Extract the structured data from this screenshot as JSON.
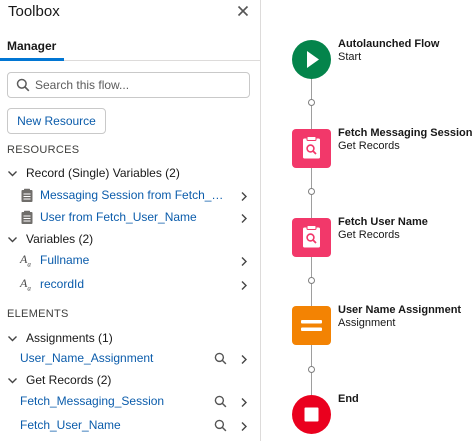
{
  "toolbox": {
    "title": "Toolbox",
    "tabs": [
      {
        "label": "Manager",
        "active": true
      }
    ],
    "search": {
      "placeholder": "Search this flow...",
      "value": ""
    },
    "new_resource_label": "New Resource",
    "resources": {
      "heading": "RESOURCES",
      "groups": [
        {
          "label": "Record (Single) Variables (2)",
          "items": [
            {
              "label": "Messaging Session from Fetch_Messaging_Session",
              "icon": "record-icon"
            },
            {
              "label": "User from Fetch_User_Name",
              "icon": "record-icon"
            }
          ]
        },
        {
          "label": "Variables (2)",
          "items": [
            {
              "label": "Fullname",
              "icon": "text-variable-icon"
            },
            {
              "label": "recordId",
              "icon": "text-variable-icon"
            }
          ]
        }
      ]
    },
    "elements": {
      "heading": "ELEMENTS",
      "groups": [
        {
          "label": "Assignments (1)",
          "items": [
            {
              "label": "User_Name_Assignment"
            }
          ]
        },
        {
          "label": "Get Records (2)",
          "items": [
            {
              "label": "Fetch_Messaging_Session"
            },
            {
              "label": "Fetch_User_Name"
            }
          ]
        }
      ]
    }
  },
  "flow": {
    "nodes": [
      {
        "title": "Autolaunched Flow",
        "subtitle": "Start",
        "icon": "play-icon",
        "color": "#04844b"
      },
      {
        "title": "Fetch Messaging Session",
        "subtitle": "Get Records",
        "icon": "get-records-icon",
        "color": "#f2386a"
      },
      {
        "title": "Fetch User Name",
        "subtitle": "Get Records",
        "icon": "get-records-icon",
        "color": "#f2386a"
      },
      {
        "title": "User Name Assignment",
        "subtitle": "Assignment",
        "icon": "assignment-icon",
        "color": "#f38303"
      },
      {
        "title": "End",
        "subtitle": "",
        "icon": "stop-icon",
        "color": "#ea001e"
      }
    ]
  },
  "colors": {
    "link": "#0b5cab",
    "tab_accent": "#0176d3"
  }
}
